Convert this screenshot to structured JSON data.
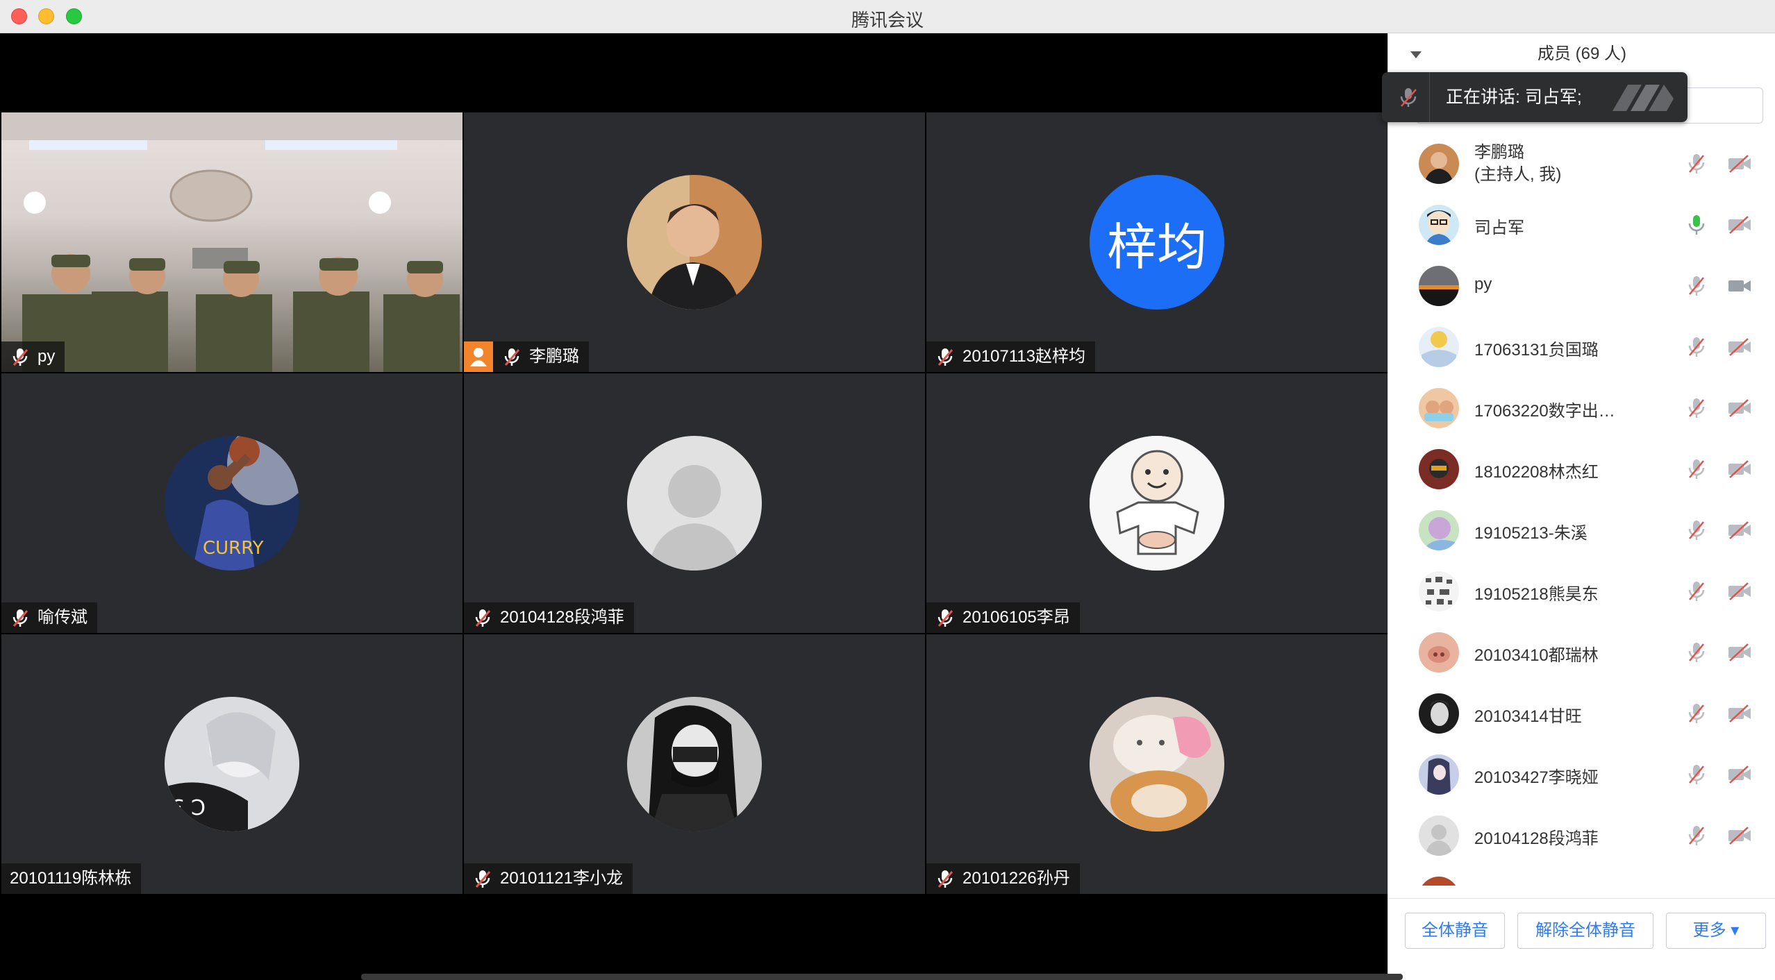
{
  "window": {
    "title": "腾讯会议"
  },
  "tiles": [
    {
      "name": "py",
      "muted": true
    },
    {
      "name": "李鹏璐",
      "muted": true,
      "host": true
    },
    {
      "name": "20107113赵梓均",
      "muted": true,
      "initials": "梓均"
    },
    {
      "name": "喻传斌",
      "muted": true
    },
    {
      "name": "20104128段鸿菲",
      "muted": true
    },
    {
      "name": "20106105李昂",
      "muted": true
    },
    {
      "name": "20101119陈林栋",
      "muted": false
    },
    {
      "name": "20101121李小龙",
      "muted": true
    },
    {
      "name": "20101226孙丹",
      "muted": true
    }
  ],
  "panel": {
    "header": "成员 (69 人)",
    "speaking": "正在讲话: 司占军;",
    "members": [
      {
        "name": "李鹏璐",
        "note": "(主持人, 我)",
        "mic": "muted",
        "cam": "off"
      },
      {
        "name": "司占军",
        "mic": "active",
        "cam": "off"
      },
      {
        "name": "py",
        "mic": "muted",
        "cam": "on"
      },
      {
        "name": "17063131贠国璐",
        "mic": "muted",
        "cam": "off"
      },
      {
        "name": "17063220数字出…",
        "mic": "muted",
        "cam": "off"
      },
      {
        "name": "18102208林杰红",
        "mic": "muted",
        "cam": "off"
      },
      {
        "name": "19105213-朱溪",
        "mic": "muted",
        "cam": "off"
      },
      {
        "name": "19105218熊昊东",
        "mic": "muted",
        "cam": "off"
      },
      {
        "name": "20103410都瑞林",
        "mic": "muted",
        "cam": "off"
      },
      {
        "name": "20103414甘旺",
        "mic": "muted",
        "cam": "off"
      },
      {
        "name": "20103427李晓娅",
        "mic": "muted",
        "cam": "off"
      },
      {
        "name": "20104128段鸿菲",
        "mic": "muted",
        "cam": "off"
      }
    ],
    "buttons": {
      "mute_all": "全体静音",
      "unmute_all": "解除全体静音",
      "more": "更多 ▾"
    }
  },
  "colors": {
    "accent": "#2d7cf6",
    "tile_bg": "#2b2c2f",
    "host_badge": "#f2852b",
    "mute_red": "#e2534b",
    "speaking_green": "#3cc04a"
  }
}
